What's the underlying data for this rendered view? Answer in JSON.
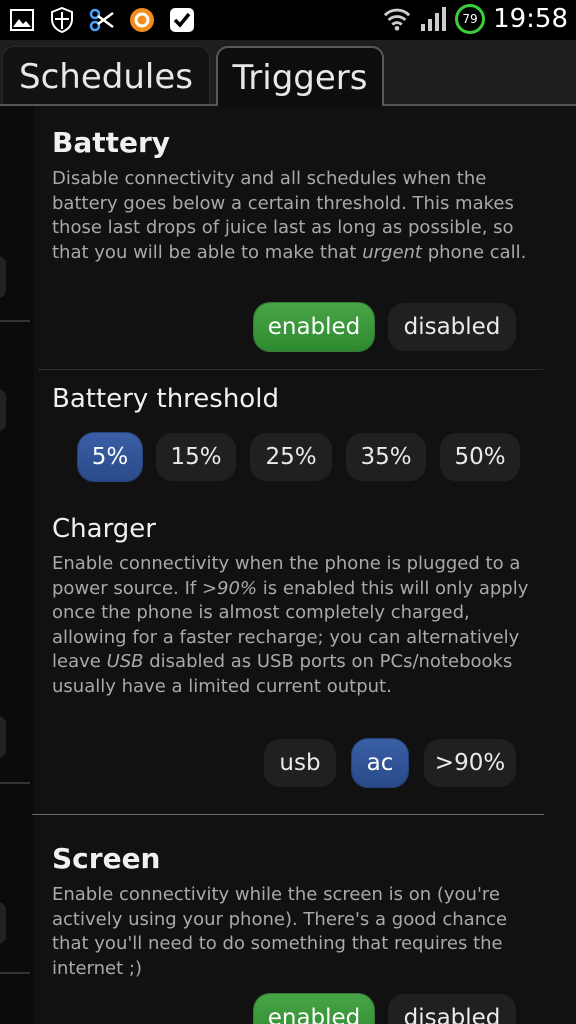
{
  "statusbar": {
    "left_icons": [
      "picture-icon",
      "shield-icon",
      "scissors-icon",
      "orange-circle-icon",
      "checkbox-icon"
    ],
    "battery_level": "79",
    "time": "19:58"
  },
  "tabs": [
    {
      "label": "Schedules",
      "active": false
    },
    {
      "label": "Triggers",
      "active": true
    }
  ],
  "battery": {
    "title": "Battery",
    "desc_part1": "Disable connectivity and all schedules when the battery goes below a certain threshold. This makes those last drops of juice last as long as possible, so that you will be able to make that ",
    "desc_em": "urgent",
    "desc_part2": " phone call.",
    "enabled_label": "enabled",
    "disabled_label": "disabled",
    "selected": "enabled"
  },
  "threshold": {
    "title": "Battery threshold",
    "options": [
      "5%",
      "15%",
      "25%",
      "35%",
      "50%"
    ],
    "selected": "5%"
  },
  "charger": {
    "title": "Charger",
    "desc_a": "Enable connectivity when the phone is plugged to a power source. If ",
    "desc_em1": ">90%",
    "desc_b": " is enabled this will only apply once the phone is almost completely charged, allowing for a faster recharge; you can alternatively leave ",
    "desc_em2": "USB",
    "desc_c": " disabled as USB ports on PCs/notebooks usually have a limited current output.",
    "options": [
      "usb",
      "ac",
      ">90%"
    ],
    "selected": "ac"
  },
  "screen": {
    "title": "Screen",
    "desc": "Enable connectivity while the screen is on (you're actively using your phone). There's a good chance that you'll need to do something that requires the internet ;)",
    "enabled_label": "enabled",
    "disabled_label": "disabled",
    "selected": "enabled"
  },
  "colors": {
    "accent_green": "#3e9c3e",
    "accent_blue": "#2f5298",
    "background": "#111111"
  }
}
